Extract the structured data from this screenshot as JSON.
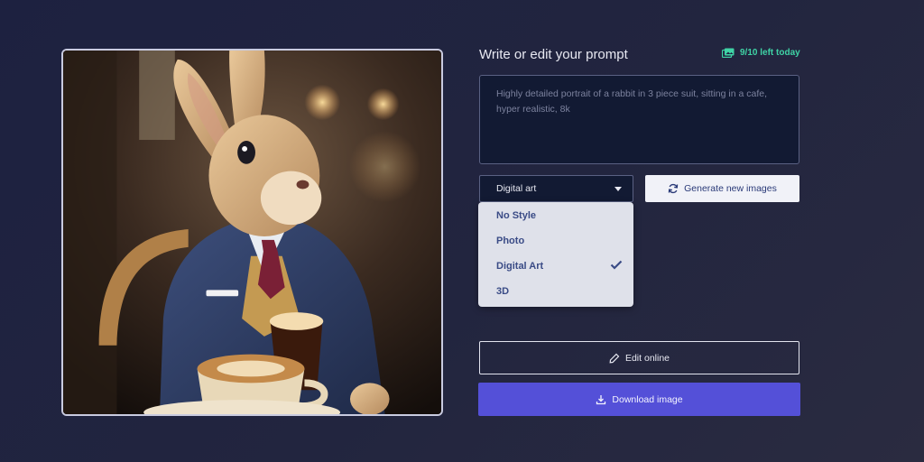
{
  "heading": "Write or edit your prompt",
  "quota": {
    "icon": "images-icon",
    "text": "9/10 left today"
  },
  "prompt": {
    "value": "Highly detailed portrait of a rabbit in 3 piece suit, sitting in a cafe, hyper realistic, 8k"
  },
  "style_select": {
    "value": "Digital art",
    "icon": "chevron-down-icon"
  },
  "generate_button": {
    "label": "Generate new images",
    "icon": "refresh-icon"
  },
  "style_options": [
    {
      "label": "No Style",
      "selected": false
    },
    {
      "label": "Photo",
      "selected": false
    },
    {
      "label": "Digital Art",
      "selected": true
    },
    {
      "label": "3D",
      "selected": false
    }
  ],
  "edit_button": {
    "label": "Edit online",
    "icon": "pencil-icon"
  },
  "download_button": {
    "label": "Download image",
    "icon": "download-icon"
  },
  "colors": {
    "accent": "#5450d8",
    "quota": "#3fd3a5",
    "option_text": "#3a4b86"
  }
}
